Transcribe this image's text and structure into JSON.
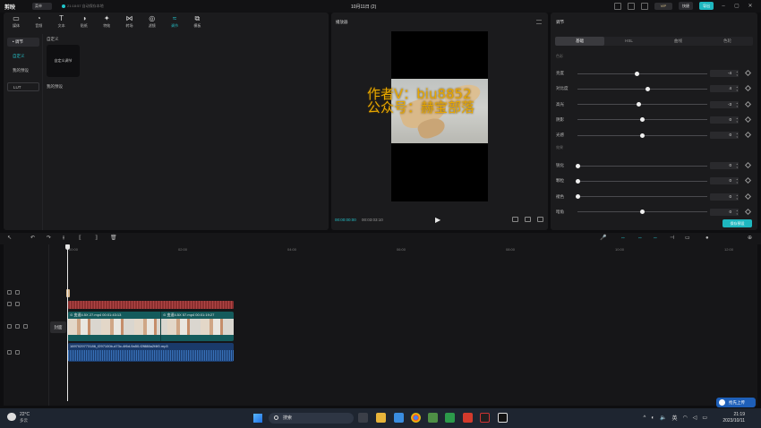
{
  "app": {
    "logo": "剪映",
    "menu_label": "菜单",
    "status_text": "21:18:57 自动保存本地",
    "project_title": "10月11日 (2)",
    "vip_label": "VIP",
    "shortcut_label": "快捷",
    "export_label": "导出"
  },
  "toolbar": [
    {
      "label": "媒体",
      "icon": "media-icon",
      "glyph": "▭"
    },
    {
      "label": "音频",
      "icon": "audio-icon",
      "glyph": "◔"
    },
    {
      "label": "文本",
      "icon": "text-icon",
      "glyph": "T"
    },
    {
      "label": "贴纸",
      "icon": "sticker-icon",
      "glyph": "◑"
    },
    {
      "label": "特效",
      "icon": "effects-icon",
      "glyph": "✦"
    },
    {
      "label": "转场",
      "icon": "transition-icon",
      "glyph": "⋈"
    },
    {
      "label": "滤镜",
      "icon": "filter-icon",
      "glyph": "◎"
    },
    {
      "label": "调节",
      "icon": "adjust-icon",
      "glyph": "≈"
    },
    {
      "label": "模板",
      "icon": "template-icon",
      "glyph": "⧉"
    }
  ],
  "sidebar": {
    "items": [
      {
        "label": "• 调节"
      },
      {
        "label": "自定义"
      },
      {
        "label": "我的预设"
      },
      {
        "label": "LUT"
      }
    ]
  },
  "media": {
    "custom_label": "自定义",
    "custom_card": "自定义调节",
    "preset_label": "我的预设"
  },
  "player": {
    "title": "播放器",
    "watermark": "作者V：biu8852\n公众号：赫宝部落",
    "current_time": "00:00:00:00",
    "total_time": "00:03:03:10"
  },
  "adjust": {
    "title": "调节",
    "tabs": [
      "基础",
      "HSL",
      "曲线",
      "色轮"
    ],
    "section1": "色彩",
    "rows1": [
      {
        "label": "亮度",
        "value": "-4",
        "pos": 0.46
      },
      {
        "label": "对比度",
        "value": "4",
        "pos": 0.54
      },
      {
        "label": "高光",
        "value": "-3",
        "pos": 0.47
      },
      {
        "label": "阴影",
        "value": "0",
        "pos": 0.5
      },
      {
        "label": "光感",
        "value": "0",
        "pos": 0.5
      }
    ],
    "section2": "效果",
    "rows2": [
      {
        "label": "锐化",
        "value": "0",
        "pos": 0.0
      },
      {
        "label": "颗粒",
        "value": "0",
        "pos": 0.0
      },
      {
        "label": "褪色",
        "value": "0",
        "pos": 0.0
      },
      {
        "label": "暗角",
        "value": "0",
        "pos": 0.5
      }
    ],
    "save_preset": "保存预设"
  },
  "timeline": {
    "ruler": [
      "00:00",
      "02:00",
      "04:00",
      "06:00",
      "08:00",
      "10:00",
      "12:00"
    ],
    "cover_label": "封面",
    "clip1_label": "⊙ 变速4.5X  27.mp4  00:01:43:13",
    "clip2_label": "⊙ 变速4.5X  57.mp4  00:01:19:27",
    "audio_label": "1697029773186_f297100b-d73c-4f6d-9a50-f2f888a2f4f0.mp3"
  },
  "taskbar": {
    "temp": "22°C",
    "weather": "多云",
    "search": "搜索",
    "lang": "英",
    "time": "21:19",
    "date": "2023/10/11",
    "upload": "抢先上传"
  }
}
